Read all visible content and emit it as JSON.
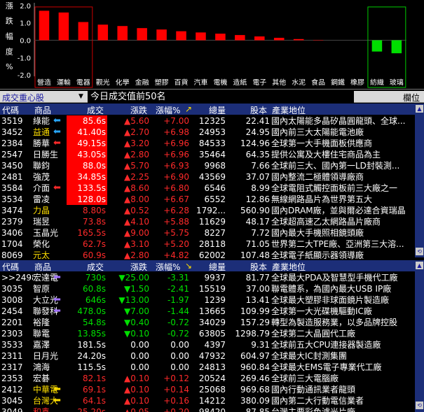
{
  "chart_data": {
    "type": "bar",
    "ylabel": "漲跌幅度%",
    "ylim": [
      -2.0,
      2.0
    ],
    "yticks": [
      "2.0",
      "1.0",
      "0.0",
      "-1.0",
      "-2.0"
    ],
    "categories": [
      "營造",
      "運輸",
      "電器",
      "觀光",
      "化學",
      "金融",
      "塑膠",
      "百貨",
      "汽車",
      "電機",
      "造紙",
      "電子",
      "其他",
      "水泥",
      "食品",
      "鋼鐵",
      "橡膠",
      "紡織",
      "玻璃"
    ],
    "values": [
      1.7,
      1.6,
      1.05,
      0.9,
      0.82,
      0.7,
      0.62,
      0.52,
      0.45,
      0.38,
      0.3,
      0.22,
      0.14,
      0.07,
      0.02,
      0.0,
      0.0,
      -0.65,
      -0.75
    ],
    "up_color": "#ff0000",
    "down_color": "#00dd00",
    "highlight_red": [
      "營造",
      "運輸",
      "電器"
    ],
    "highlight_green": [
      "紡織",
      "玻璃"
    ],
    "grid": false
  },
  "toolbar": {
    "group_label": "成交重心股",
    "dropdown_arrow": "▼",
    "title": "今日成交值前50名",
    "right_label": "欄位"
  },
  "headers1": {
    "code": "代碼",
    "name": "商品",
    "price": "成交",
    "chg": "漲跌",
    "pct": "漲幅%",
    "sort": "↗",
    "vol": "總量",
    "cap": "股本",
    "desc": "產業地位"
  },
  "headers2": {
    "code": "代碼",
    "name": "商品",
    "price": "成交",
    "chg": "漲跌",
    "pct": "漲幅%",
    "sort": "↘",
    "vol": "總量",
    "cap": "股本",
    "desc": "產業地位"
  },
  "rows1": [
    {
      "code": "3519",
      "name": "綠能",
      "price": "85.6s",
      "chg": "▲5.60",
      "pct": "+7.00",
      "vol": "12325",
      "cap": "22.41",
      "desc": "國內太陽能多晶矽晶圓龍頭、全球..."
    },
    {
      "code": "3452",
      "name": "益通",
      "price": "41.40s",
      "chg": "▲2.70",
      "pct": "+6.98",
      "vol": "24953",
      "cap": "24.95",
      "desc": "國內前三大太陽能電池廠"
    },
    {
      "code": "2384",
      "name": "勝華",
      "price": "49.15s",
      "chg": "▲3.20",
      "pct": "+6.96",
      "vol": "84533",
      "cap": "124.96",
      "desc": "全球第一大手機面板供應商"
    },
    {
      "code": "2547",
      "name": "日勝生",
      "price": "43.05s",
      "chg": "▲2.80",
      "pct": "+6.96",
      "vol": "35464",
      "cap": "64.35",
      "desc": "提供公寓及大樓住宅商品為主"
    },
    {
      "code": "3450",
      "name": "聯鈞",
      "price": "88.0s",
      "chg": "▲5.70",
      "pct": "+6.93",
      "vol": "9968",
      "cap": "7.66",
      "desc": "全球前三大、國內第一LD封裝測..."
    },
    {
      "code": "2481",
      "name": "強茂",
      "price": "34.85s",
      "chg": "▲2.25",
      "pct": "+6.90",
      "vol": "43569",
      "cap": "37.07",
      "desc": "國內整流二極體領導廠商"
    },
    {
      "code": "3584",
      "name": "介面",
      "price": "133.5s",
      "chg": "▲8.60",
      "pct": "+6.80",
      "vol": "6546",
      "cap": "8.99",
      "desc": "全球電阻式觸控面板前三大廠之一"
    },
    {
      "code": "3534",
      "name": "雷凌",
      "price": "128.0s",
      "chg": "▲8.00",
      "pct": "+6.67",
      "vol": "6552",
      "cap": "12.86",
      "desc": "無線網路晶片為世界第五大"
    },
    {
      "code": "3474",
      "name": "力晶",
      "price": "8.80s",
      "chg": "▲0.52",
      "pct": "+6.28",
      "vol": "1792...",
      "cap": "560.90",
      "desc": "國內DRAM廠，並與爾必達合資瑞晶"
    },
    {
      "code": "2379",
      "name": "瑞昱",
      "price": "73.8s",
      "chg": "▲4.10",
      "pct": "+5.88",
      "vol": "11629",
      "cap": "48.17",
      "desc": "全球超高速乙太網路晶片廠商"
    },
    {
      "code": "3406",
      "name": "玉晶光",
      "price": "165.5s",
      "chg": "▲9.00",
      "pct": "+5.75",
      "vol": "8227",
      "cap": "7.72",
      "desc": "國內最大手機照相鏡頭廠"
    },
    {
      "code": "1704",
      "name": "榮化",
      "price": "62.7s",
      "chg": "▲3.10",
      "pct": "+5.20",
      "vol": "28118",
      "cap": "71.05",
      "desc": "世界第二大TPE廠、亞洲第三大溶..."
    },
    {
      "code": "8069",
      "name": "元太",
      "price": "60.9s",
      "chg": "▲2.80",
      "pct": "+4.82",
      "vol": "62002",
      "cap": "107.48",
      "desc": "全球電子紙顯示器領導廠"
    }
  ],
  "rows2": [
    {
      "code": ">>2498",
      "name": "宏達電",
      "price": "730s",
      "chg": "▼25.00",
      "pct": "-3.31",
      "vol": "9937",
      "cap": "81.77",
      "desc": "全球最大PDA及智慧型手機代工廠"
    },
    {
      "code": "3035",
      "name": "智原",
      "price": "60.8s",
      "chg": "▼1.50",
      "pct": "-2.41",
      "vol": "15519",
      "cap": "37.00",
      "desc": "聯電體系，為國內最大USB IP廠"
    },
    {
      "code": "3008",
      "name": "大立光",
      "price": "646s",
      "chg": "▼13.00",
      "pct": "-1.97",
      "vol": "1239",
      "cap": "13.41",
      "desc": "全球最大塑膠非球面鏡片製造廠"
    },
    {
      "code": "2454",
      "name": "聯發科",
      "price": "478.0s",
      "chg": "▼7.00",
      "pct": "-1.44",
      "vol": "13665",
      "cap": "109.99",
      "desc": "全球第一大光碟機驅動IC廠"
    },
    {
      "code": "2201",
      "name": "裕隆",
      "price": "54.8s",
      "chg": "▼0.40",
      "pct": "-0.72",
      "vol": "34029",
      "cap": "157.29",
      "desc": "轉型為製造服務業，以多品牌控股"
    },
    {
      "code": "2303",
      "name": "聯電",
      "price": "13.85s",
      "chg": "▼0.10",
      "pct": "-0.72",
      "vol": "63805",
      "cap": "1298.79",
      "desc": "全球第二大晶圓代工廠"
    },
    {
      "code": "3533",
      "name": "嘉澤",
      "price": "181.5s",
      "chg": "0.00",
      "pct": "0.00",
      "vol": "4397",
      "cap": "9.31",
      "desc": "全球前五大CPU連接器製造廠"
    },
    {
      "code": "2311",
      "name": "日月光",
      "price": "24.20s",
      "chg": "0.00",
      "pct": "0.00",
      "vol": "47932",
      "cap": "604.97",
      "desc": "全球最大IC封測集團"
    },
    {
      "code": "2317",
      "name": "鴻海",
      "price": "115.5s",
      "chg": "0.00",
      "pct": "0.00",
      "vol": "24813",
      "cap": "960.84",
      "desc": "全球最大EMS電子專業代工廠"
    },
    {
      "code": "2353",
      "name": "宏碁",
      "price": "82.1s",
      "chg": "▲0.10",
      "pct": "+0.12",
      "vol": "20524",
      "cap": "269.46",
      "desc": "全球前三大電腦廠"
    },
    {
      "code": "2412",
      "name": "中華電",
      "price": "69.1s",
      "chg": "▲0.10",
      "pct": "+0.14",
      "vol": "25068",
      "cap": "969.68",
      "desc": "國內行動通訊業者龍頭"
    },
    {
      "code": "3045",
      "name": "台灣大",
      "price": "64.1s",
      "chg": "▲0.10",
      "pct": "+0.16",
      "vol": "14212",
      "cap": "380.09",
      "desc": "國內第二大行動電信業者"
    },
    {
      "code": "3049",
      "name": "和鑫",
      "price": "25.20s",
      "chg": "▲0.05",
      "pct": "+0.20",
      "vol": "98420",
      "cap": "87.85",
      "desc": "台灣主要彩色濾光片廠"
    }
  ]
}
